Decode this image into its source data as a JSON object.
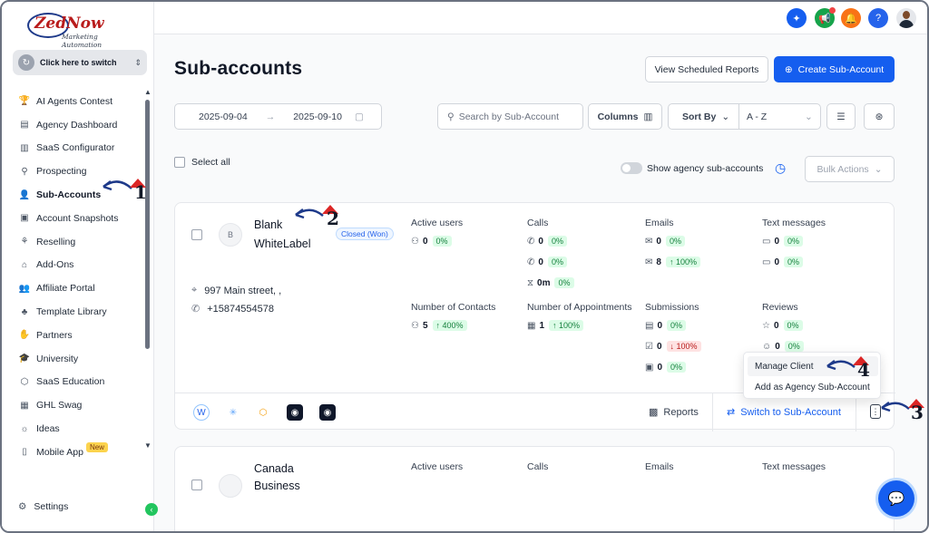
{
  "brand": {
    "logo_text": "ZedNow",
    "logo_sub": "Marketing Automation"
  },
  "switcher": {
    "label": "Click here to switch"
  },
  "sidebar": {
    "items": [
      {
        "label": "AI Agents Contest",
        "icon": "trophy-icon",
        "glyph": "🏆"
      },
      {
        "label": "Agency Dashboard",
        "icon": "dashboard-icon",
        "glyph": "▤"
      },
      {
        "label": "SaaS Configurator",
        "icon": "bar-chart-icon",
        "glyph": "▥"
      },
      {
        "label": "Prospecting",
        "icon": "users-search-icon",
        "glyph": "⚲"
      },
      {
        "label": "Sub-Accounts",
        "icon": "user-icon",
        "glyph": "👤",
        "active": true
      },
      {
        "label": "Account Snapshots",
        "icon": "snapshot-icon",
        "glyph": "▣"
      },
      {
        "label": "Reselling",
        "icon": "network-icon",
        "glyph": "⚘"
      },
      {
        "label": "Add-Ons",
        "icon": "bag-icon",
        "glyph": "⌂"
      },
      {
        "label": "Affiliate Portal",
        "icon": "group-icon",
        "glyph": "👥"
      },
      {
        "label": "Template Library",
        "icon": "library-icon",
        "glyph": "♣"
      },
      {
        "label": "Partners",
        "icon": "handshake-icon",
        "glyph": "✋"
      },
      {
        "label": "University",
        "icon": "graduation-cap-icon",
        "glyph": "🎓"
      },
      {
        "label": "SaaS Education",
        "icon": "cube-icon",
        "glyph": "⬡"
      },
      {
        "label": "GHL Swag",
        "icon": "store-icon",
        "glyph": "▦"
      },
      {
        "label": "Ideas",
        "icon": "bulb-icon",
        "glyph": "☼"
      },
      {
        "label": "Mobile App",
        "icon": "mobile-icon",
        "glyph": "▯",
        "badge": "New"
      }
    ],
    "settings_label": "Settings"
  },
  "header": {
    "title": "Sub-accounts",
    "view_reports": "View Scheduled Reports",
    "create": "Create Sub-Account"
  },
  "filters": {
    "date_start": "2025-09-04",
    "date_end": "2025-09-10",
    "search_placeholder": "Search by Sub-Account",
    "columns": "Columns",
    "sort_by": "Sort By",
    "sort_value": "A - Z"
  },
  "list_controls": {
    "select_all": "Select all",
    "show_agency": "Show agency sub-accounts",
    "bulk_actions": "Bulk Actions"
  },
  "card1": {
    "avatar_letter": "B",
    "name_line1": "Blank",
    "name_line2": "WhiteLabel",
    "status": "Closed (Won)",
    "address": "997 Main street, ,",
    "phone": "+15874554578",
    "active_users": {
      "label": "Active users",
      "value": "0",
      "pct": "0%"
    },
    "calls": {
      "label": "Calls",
      "rows": [
        {
          "value": "0",
          "pct": "0%"
        },
        {
          "value": "0",
          "pct": "0%"
        },
        {
          "value": "0m",
          "pct": "0%"
        }
      ]
    },
    "emails": {
      "label": "Emails",
      "rows": [
        {
          "value": "0",
          "pct": "0%"
        },
        {
          "value": "8",
          "pct": "↑ 100%"
        }
      ]
    },
    "texts": {
      "label": "Text messages",
      "rows": [
        {
          "value": "0",
          "pct": "0%"
        },
        {
          "value": "0",
          "pct": "0%"
        }
      ]
    },
    "contacts": {
      "label": "Number of Contacts",
      "value": "5",
      "pct": "↑ 400%"
    },
    "appointments": {
      "label": "Number of Appointments",
      "value": "1",
      "pct": "↑ 100%"
    },
    "submissions": {
      "label": "Submissions",
      "rows": [
        {
          "value": "0",
          "pct": "0%"
        },
        {
          "value": "0",
          "pct": "↓ 100%"
        },
        {
          "value": "0",
          "pct": "0%"
        }
      ]
    },
    "reviews": {
      "label": "Reviews",
      "rows": [
        {
          "value": "0",
          "pct": "0%"
        },
        {
          "value": "0",
          "pct": "0%"
        }
      ]
    },
    "reports": "Reports",
    "switch": "Switch to Sub-Account"
  },
  "card2": {
    "name_line1": "Canada",
    "name_line2": "Business",
    "active_users_label": "Active users",
    "calls_label": "Calls",
    "emails_label": "Emails",
    "texts_label": "Text messages"
  },
  "menu": {
    "manage": "Manage Client",
    "add_agency": "Add as Agency Sub-Account"
  },
  "annotations": [
    "1",
    "2",
    "3",
    "4"
  ],
  "colors": {
    "primary": "#155eef",
    "annotation": "#dc2626"
  }
}
